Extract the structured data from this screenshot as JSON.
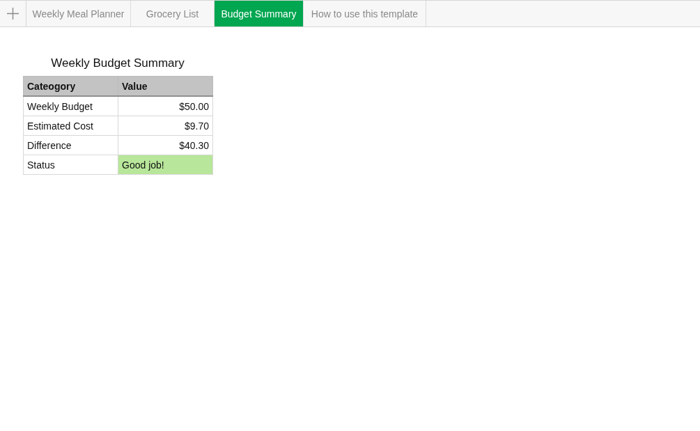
{
  "tabs": [
    {
      "label": "Weekly Meal Planner",
      "selected": false
    },
    {
      "label": "Grocery List",
      "selected": false
    },
    {
      "label": "Budget Summary",
      "selected": true
    },
    {
      "label": "How to use this template",
      "selected": false
    }
  ],
  "table": {
    "title": "Weekly Budget Summary",
    "columns": [
      "Cateogory",
      "Value"
    ],
    "rows": [
      {
        "category": "Weekly Budget",
        "value": "$50.00",
        "kind": "amount"
      },
      {
        "category": "Estimated Cost",
        "value": "$9.70",
        "kind": "amount"
      },
      {
        "category": "Difference",
        "value": "$40.30",
        "kind": "amount"
      },
      {
        "category": "Status",
        "value": "Good job!",
        "kind": "text",
        "color": "#b8e69a"
      }
    ]
  }
}
